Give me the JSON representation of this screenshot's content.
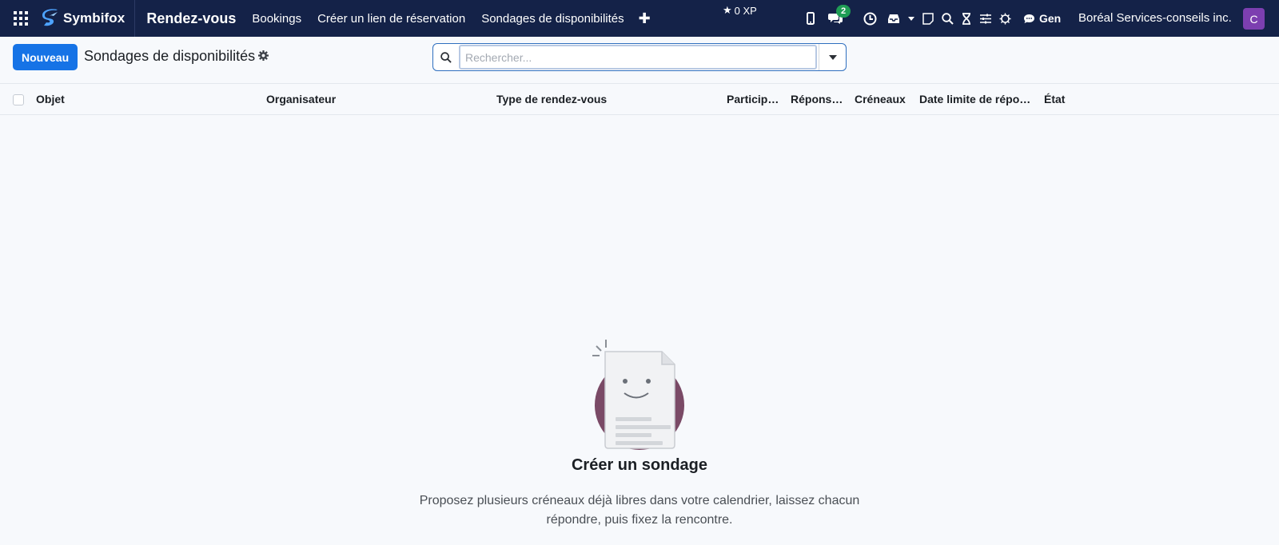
{
  "navbar": {
    "brand": "Symbifox",
    "app_title": "Rendez-vous",
    "menu": [
      "Bookings",
      "Créer un lien de réservation",
      "Sondages de disponibilités"
    ],
    "xp": "0 XP",
    "chat_count": "2",
    "gen_label": "Gen",
    "company": "Boréal Services-conseils inc.",
    "avatar_letter": "C"
  },
  "control_panel": {
    "new_button": "Nouveau",
    "title": "Sondages de disponibilités",
    "search_placeholder": "Rechercher..."
  },
  "list": {
    "columns": [
      "Objet",
      "Organisateur",
      "Type de rendez-vous",
      "Participants",
      "Réponses",
      "Créneaux",
      "Date limite de réponse",
      "État"
    ]
  },
  "empty_state": {
    "title": "Créer un sondage",
    "text": "Proposez plusieurs créneaux déjà libres dans votre calendrier, laissez chacun répondre, puis fixez la rencontre."
  },
  "colors": {
    "navbar": "#142248",
    "primary": "#1673e6",
    "avatar": "#7c3fb0",
    "badge": "#1f9d55"
  }
}
